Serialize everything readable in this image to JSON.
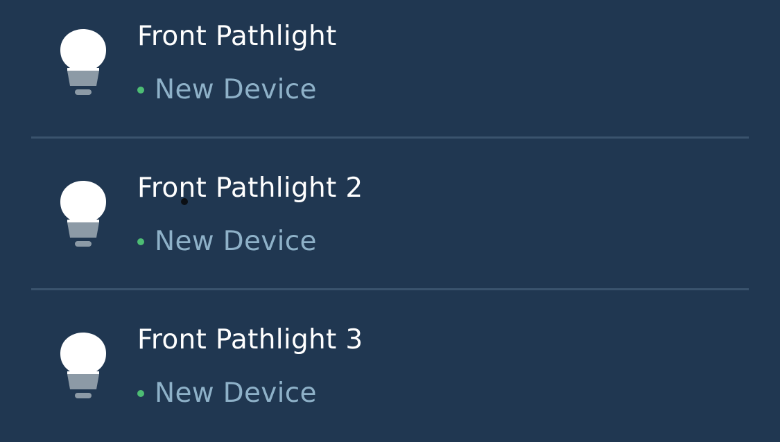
{
  "colors": {
    "background": "#203751",
    "divider": "#3a536d",
    "status_dot": "#4dbd74",
    "status_text": "#8eb1c8",
    "name_text": "#ffffff",
    "bulb_globe": "#ffffff",
    "bulb_base": "#8c9aa6"
  },
  "devices": [
    {
      "name": "Front Pathlight",
      "status": "New Device",
      "icon": "light-bulb-icon"
    },
    {
      "name": "Front Pathlight 2",
      "status": "New Device",
      "icon": "light-bulb-icon"
    },
    {
      "name": "Front Pathlight 3",
      "status": "New Device",
      "icon": "light-bulb-icon"
    }
  ]
}
